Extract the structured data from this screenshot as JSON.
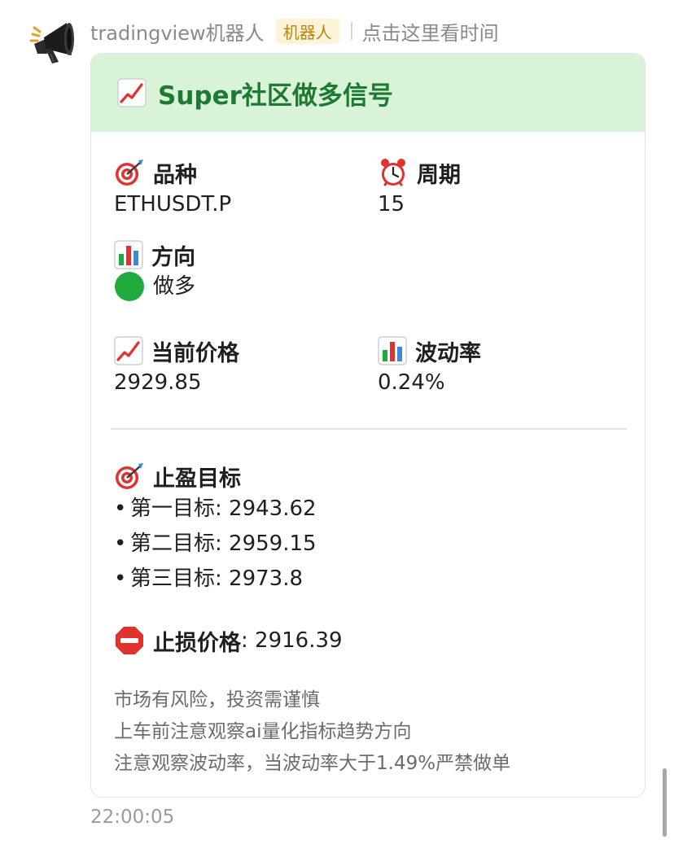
{
  "header": {
    "sender": "tradingview机器人",
    "tag": "机器人",
    "time_link": "点击这里看时间"
  },
  "card": {
    "title": "Super社区做多信号",
    "fields": {
      "symbol": {
        "label": "品种",
        "value": "ETHUSDT.P"
      },
      "period": {
        "label": "周期",
        "value": "15"
      },
      "direction": {
        "label": "方向",
        "value": "做多"
      },
      "price": {
        "label": "当前价格",
        "value": "2929.85"
      },
      "volatility": {
        "label": "波动率",
        "value": "0.24%"
      }
    },
    "take_profit": {
      "label": "止盈目标",
      "targets": [
        {
          "text": "第一目标: 2943.62"
        },
        {
          "text": "第二目标: 2959.15"
        },
        {
          "text": "第三目标: 2973.8"
        }
      ]
    },
    "stop_loss": {
      "label": "止损价格",
      "value": ": 2916.39"
    },
    "notes": [
      "市场有风险，投资需谨慎",
      "上车前注意观察ai量化指标趋势方向",
      "注意观察波动率，当波动率大于1.49%严禁做单"
    ]
  },
  "footer": {
    "time": "22:00:05"
  },
  "colors": {
    "header_bg": "#d9f3d9",
    "title_green": "#1e7a33",
    "tag_text": "#b8860b",
    "tag_bg": "#fdf3d8",
    "long_dot": "#1faa3c",
    "stop_red": "#e0322f"
  },
  "icons": {
    "avatar": "megaphone-icon",
    "title": "chart-increasing-icon",
    "symbol": "target-icon",
    "period": "alarm-clock-icon",
    "direction": "bar-chart-icon",
    "direction_value": "green-circle-icon",
    "price": "chart-increasing-icon",
    "volatility": "bar-chart-icon",
    "take_profit": "target-icon",
    "stop_loss": "stop-sign-icon"
  }
}
